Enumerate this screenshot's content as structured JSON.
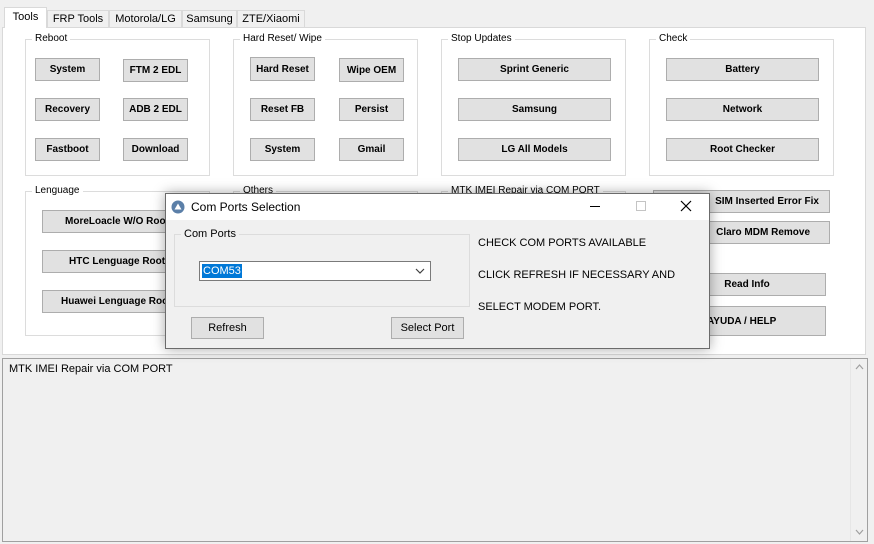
{
  "tabs": [
    {
      "label": "Tools",
      "active": true
    },
    {
      "label": "FRP Tools"
    },
    {
      "label": "Motorola/LG"
    },
    {
      "label": "Samsung"
    },
    {
      "label": "ZTE/Xiaomi"
    }
  ],
  "groups": {
    "reboot": {
      "title": "Reboot",
      "buttons": [
        "System",
        "FTM 2 EDL",
        "Recovery",
        "ADB 2 EDL",
        "Fastboot",
        "Download"
      ]
    },
    "hard_reset": {
      "title": "Hard Reset/ Wipe",
      "buttons": [
        "Hard Reset",
        "Wipe OEM",
        "Reset FB",
        "Persist",
        "System",
        "Gmail"
      ]
    },
    "stop_updates": {
      "title": "Stop Updates",
      "buttons": [
        "Sprint Generic",
        "Samsung",
        "LG All Models"
      ]
    },
    "check": {
      "title": "Check",
      "buttons": [
        "Battery",
        "Network",
        "Root Checker"
      ]
    },
    "language": {
      "title": "Lenguage",
      "buttons": [
        "MoreLoacle W/O Root",
        "HTC Lenguage  Root",
        "Huawei Lenguage Root"
      ]
    },
    "others": {
      "title": "Others"
    },
    "mtk": {
      "title": "MTK IMEI Repair via COM PORT"
    },
    "right_buttons": [
      "SIM Inserted  Error Fix",
      "Claro MDM Remove",
      "Read Info",
      "AYUDA / HELP"
    ]
  },
  "log": {
    "text": "MTK IMEI Repair via COM PORT"
  },
  "dialog": {
    "title": "Com Ports Selection",
    "minimize": "—",
    "maximize": "☐",
    "close": "✕",
    "group_title": "Com Ports",
    "selected_port": "COM53",
    "messages": [
      "CHECK COM PORTS AVAILABLE",
      "CLICK REFRESH IF NECESSARY AND",
      "SELECT MODEM PORT."
    ],
    "refresh_label": "Refresh",
    "select_label": "Select Port"
  },
  "colors": {
    "selection": "#0078d7",
    "button_face": "#e1e1e1",
    "button_border": "#adadad"
  }
}
